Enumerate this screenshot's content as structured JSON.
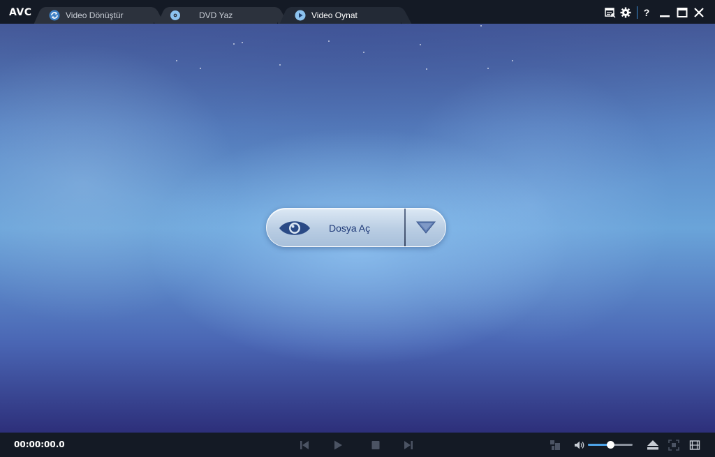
{
  "app": {
    "logo": "AVC"
  },
  "tabs": [
    {
      "label": "Video Dönüştür",
      "icon": "refresh-icon",
      "active": false
    },
    {
      "label": "DVD Yaz",
      "icon": "disc-icon",
      "active": false
    },
    {
      "label": "Video Oynat",
      "icon": "play-circle-icon",
      "active": true
    }
  ],
  "window_controls": {
    "icons": [
      "log-icon",
      "gear-icon",
      "help-icon",
      "minimize-icon",
      "maximize-icon",
      "close-icon"
    ],
    "help_glyph": "?"
  },
  "main": {
    "open_button_label": "Dosya Aç",
    "open_icon": "eye-icon",
    "dropdown_icon": "triangle-down-icon"
  },
  "player": {
    "time": "00:00:00.0",
    "volume_level": 0.5,
    "controls": [
      "previous-icon",
      "play-icon",
      "stop-icon",
      "next-icon"
    ],
    "right_controls": [
      "snapshot-icon",
      "volume-icon",
      "eject-icon",
      "fullscreen-icon",
      "film-icon"
    ]
  },
  "colors": {
    "accent": "#4ea3e8",
    "titlebar": "#141a25",
    "button_text": "#1f3a78"
  }
}
